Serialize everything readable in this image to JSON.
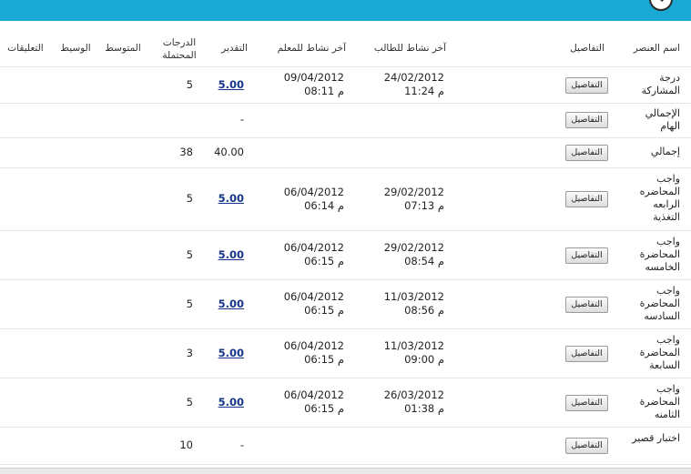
{
  "header": {
    "col_name": "اسم العنصر",
    "col_details": "التفاصيل",
    "col_last_student": "آخر نشاط للطالب",
    "col_last_teacher": "آخر نشاط للمعلم",
    "col_grade": "التقدير",
    "col_possible": "الدرجات المحتملة",
    "col_average": "المتوسط",
    "col_median": "الوسيط",
    "col_comments": "التعليقات"
  },
  "details_label": "التفاصيل",
  "rows": [
    {
      "name": "درجة المشاركة",
      "student_date": "24/02/2012",
      "student_time": "11:24 م",
      "teacher_date": "09/04/2012",
      "teacher_time": "08:11 م",
      "grade": "5.00",
      "possible": "5"
    },
    {
      "name": "الإجمالي الهام",
      "student_date": "",
      "student_time": "",
      "teacher_date": "",
      "teacher_time": "",
      "grade": "-",
      "possible": ""
    },
    {
      "name": "إجمالي",
      "student_date": "",
      "student_time": "",
      "teacher_date": "",
      "teacher_time": "",
      "grade": "40.00",
      "possible": "38"
    },
    {
      "name": "واجب المحاضره الرابعه التغذية",
      "student_date": "29/02/2012",
      "student_time": "07:13 م",
      "teacher_date": "06/04/2012",
      "teacher_time": "06:14 م",
      "grade": "5.00",
      "possible": "5"
    },
    {
      "name": "واجب المحاضرة الخامسه",
      "student_date": "29/02/2012",
      "student_time": "08:54 م",
      "teacher_date": "06/04/2012",
      "teacher_time": "06:15 م",
      "grade": "5.00",
      "possible": "5"
    },
    {
      "name": "واجب المحاضرة السادسه",
      "student_date": "11/03/2012",
      "student_time": "08:56 م",
      "teacher_date": "06/04/2012",
      "teacher_time": "06:15 م",
      "grade": "5.00",
      "possible": "5"
    },
    {
      "name": "واجب المحاضرة السابعة",
      "student_date": "11/03/2012",
      "student_time": "09:00 م",
      "teacher_date": "06/04/2012",
      "teacher_time": "06:15 م",
      "grade": "5.00",
      "possible": "3"
    },
    {
      "name": "واجب المحاضرة الثامنه",
      "student_date": "26/03/2012",
      "student_time": "01:38 م",
      "teacher_date": "06/04/2012",
      "teacher_time": "06:15 م",
      "grade": "5.00",
      "possible": "5"
    },
    {
      "name": "اختبار قصير",
      "student_date": "",
      "student_time": "",
      "teacher_date": "",
      "teacher_time": "",
      "grade": "-",
      "possible": "10"
    }
  ]
}
